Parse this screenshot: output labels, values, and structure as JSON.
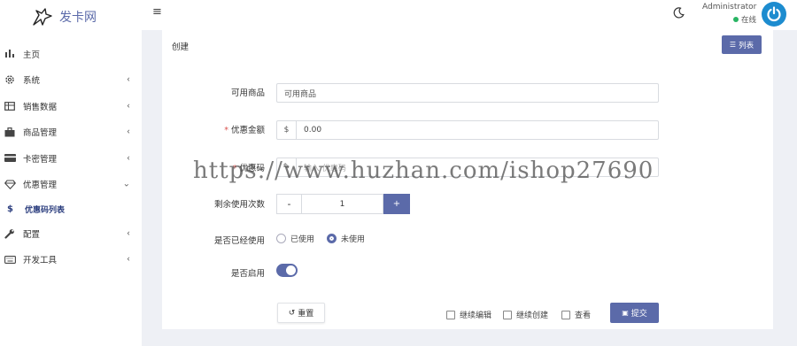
{
  "app": {
    "logo_text": "发卡网"
  },
  "sidebar": {
    "items": [
      {
        "label": "主页",
        "icon": "bar-chart-icon",
        "arrow": ""
      },
      {
        "label": "系统",
        "icon": "gear-icon",
        "arrow": "‹"
      },
      {
        "label": "销售数据",
        "icon": "table-icon",
        "arrow": "‹"
      },
      {
        "label": "商品管理",
        "icon": "bag-icon",
        "arrow": "‹"
      },
      {
        "label": "卡密管理",
        "icon": "card-icon",
        "arrow": "‹"
      },
      {
        "label": "优惠管理",
        "icon": "diamond-icon",
        "arrow": "⌄"
      }
    ],
    "sub_item": {
      "label": "优惠码列表",
      "icon": "$"
    },
    "items2": [
      {
        "label": "配置",
        "icon": "wrench-icon",
        "arrow": "‹"
      },
      {
        "label": "开发工具",
        "icon": "keyboard-icon",
        "arrow": "‹"
      }
    ]
  },
  "topbar": {
    "menu_icon": "≡",
    "user_name": "Administrator",
    "user_status": "在线"
  },
  "card": {
    "title": "创建",
    "list_button": "列表"
  },
  "form": {
    "goods": {
      "label": "可用商品",
      "value": "可用商品"
    },
    "discount": {
      "label": "优惠金额",
      "addon": "$",
      "value": "0.00"
    },
    "code": {
      "label": "优惠码",
      "placeholder": "输入 优惠码"
    },
    "remaining": {
      "label": "剩余使用次数",
      "value": "1",
      "minus": "-",
      "plus": "+"
    },
    "used": {
      "label": "是否已经使用",
      "options": [
        "已使用",
        "未使用"
      ],
      "selected": "未使用"
    },
    "enabled": {
      "label": "是否启用",
      "value": true
    },
    "reset_label": "重置",
    "checks": [
      "继续编辑",
      "继续创建",
      "查看"
    ],
    "submit_label": "提交"
  },
  "watermark": "https://www.huzhan.com/ishop27690",
  "colors": {
    "accent": "#5b6aa9",
    "status": "#28b463",
    "avatar": "#1d8ccf"
  }
}
